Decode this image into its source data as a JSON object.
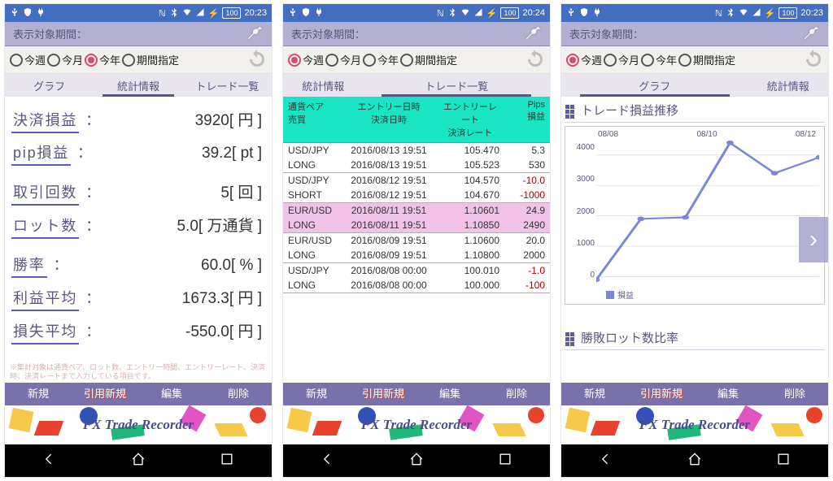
{
  "status": {
    "battery": "100"
  },
  "screens": [
    {
      "time": "20:23"
    },
    {
      "time": "20:24"
    },
    {
      "time": "20:23"
    }
  ],
  "header": {
    "title": "表示対象期間："
  },
  "period": {
    "options": [
      "今週",
      "今月",
      "今年",
      "期間指定"
    ],
    "selected": [
      2,
      0,
      0
    ]
  },
  "tabs": {
    "labels": [
      "グラフ",
      "統計情報",
      "トレード一覧"
    ],
    "active": [
      1,
      2,
      0
    ]
  },
  "stats": {
    "rows": [
      {
        "label": "決済損益",
        "value": "3920[ 円 ]"
      },
      {
        "label": "pip損益",
        "value": "39.2[ pt ]"
      }
    ],
    "rows2": [
      {
        "label": "取引回数",
        "value": "5[ 回 ]"
      },
      {
        "label": "ロット数",
        "value": "5.0[ 万通貨 ]"
      }
    ],
    "rows3": [
      {
        "label": "勝率",
        "value": "60.0[ % ]"
      },
      {
        "label": "利益平均",
        "value": "1673.3[ 円 ]"
      },
      {
        "label": "損失平均",
        "value": "-550.0[ 円 ]"
      }
    ],
    "footnote": "※集計対象は通貨ペア、ロット数、エントリー時間、エントリーレート、決済時、決済レートまで入力している項目です。"
  },
  "trade_table": {
    "headers": {
      "pair": "通貨ペア",
      "side": "売買",
      "entry_dt": "エントリー日時",
      "close_dt": "決済日時",
      "entry_rate": "エントリーレート",
      "close_rate": "決済レート",
      "pips": "Pips",
      "pl": "損益"
    },
    "rows": [
      {
        "pair": "USD/JPY",
        "side": "LONG",
        "ed": "2016/08/13 19:51",
        "cd": "2016/08/13 19:51",
        "er": "105.470",
        "cr": "105.523",
        "pips": "5.3",
        "pl": "530"
      },
      {
        "pair": "USD/JPY",
        "side": "SHORT",
        "ed": "2016/08/12 19:51",
        "cd": "2016/08/12 19:51",
        "er": "104.570",
        "cr": "104.670",
        "pips": "-10.0",
        "pl": "-1000"
      },
      {
        "pair": "EUR/USD",
        "side": "LONG",
        "ed": "2016/08/11 19:51",
        "cd": "2016/08/11 19:51",
        "er": "1.10601",
        "cr": "1.10850",
        "pips": "24.9",
        "pl": "2490",
        "hl": true
      },
      {
        "pair": "EUR/USD",
        "side": "LONG",
        "ed": "2016/08/09 19:51",
        "cd": "2016/08/09 19:51",
        "er": "1.10600",
        "cr": "1.10800",
        "pips": "20.0",
        "pl": "2000"
      },
      {
        "pair": "USD/JPY",
        "side": "LONG",
        "ed": "2016/08/08 00:00",
        "cd": "2016/08/08 00:00",
        "er": "100.010",
        "cr": "100.000",
        "pips": "-1.0",
        "pl": "-100"
      }
    ]
  },
  "chart": {
    "title1": "トレード損益推移",
    "title2": "勝敗ロット数比率",
    "legend": "損益"
  },
  "chart_data": {
    "type": "line",
    "title": "トレード損益推移",
    "xlabel": "",
    "ylabel": "",
    "x_ticks": [
      "08/08",
      "08/10",
      "08/12"
    ],
    "y_ticks": [
      0,
      1000,
      2000,
      3000,
      4000
    ],
    "ylim": [
      -200,
      4500
    ],
    "series": [
      {
        "name": "損益",
        "color": "#7b86d9",
        "x": [
          "08/08",
          "08/09",
          "08/10",
          "08/11",
          "08/12",
          "08/13"
        ],
        "values": [
          -100,
          1900,
          1950,
          4400,
          3400,
          3920
        ]
      }
    ]
  },
  "actions": {
    "labels": [
      "新規",
      "引用新規",
      "編集",
      "削除"
    ],
    "labels_alt": [
      "新規",
      "引用新規",
      "編集",
      "削除"
    ]
  },
  "banner": {
    "text": "FX Trade Recorder"
  }
}
